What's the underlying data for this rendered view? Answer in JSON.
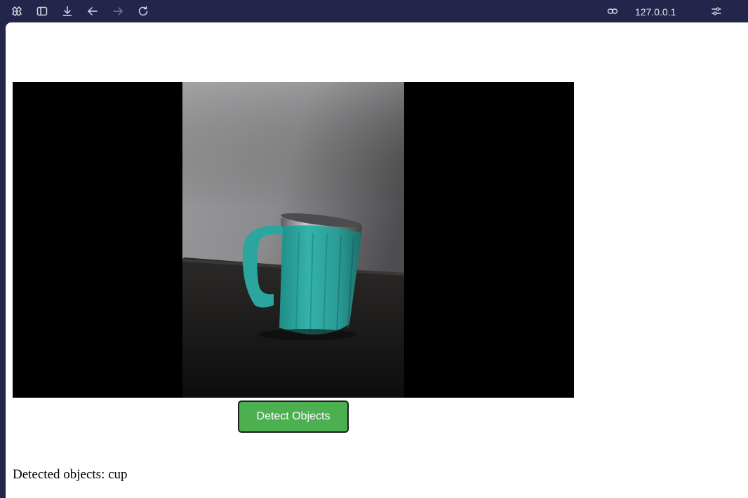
{
  "browser": {
    "address": "127.0.0.1",
    "icons": {
      "logo": "browser-logo-icon",
      "sidebar": "sidebar-toggle-icon",
      "download": "download-icon",
      "back": "back-arrow-icon",
      "forward": "forward-arrow-icon",
      "reload": "reload-icon",
      "link": "link-icon",
      "settings": "site-settings-icon"
    }
  },
  "page": {
    "detect_button_label": "Detect Objects",
    "result_label": "Detected objects:",
    "result_value": "cup"
  },
  "colors": {
    "toolbar_bg": "#23254a",
    "button_bg": "#4caf50",
    "video_bg": "#000000",
    "mug": "#2a9d96"
  }
}
